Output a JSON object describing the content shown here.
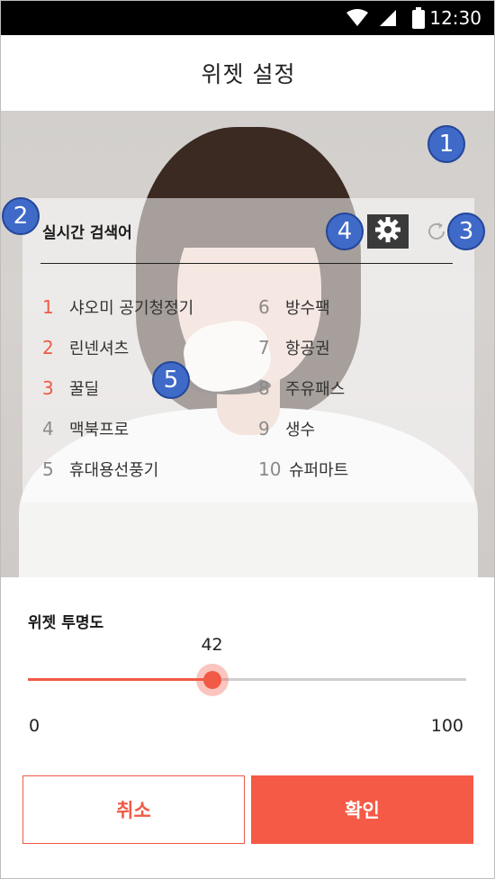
{
  "status_bar": {
    "time": "12:30",
    "icons": [
      "wifi-icon",
      "cell-signal-icon",
      "battery-icon"
    ]
  },
  "header": {
    "title": "위젯 설정"
  },
  "preview": {
    "widget": {
      "title": "실시간 검색어",
      "settings_icon": "gear-icon",
      "refresh_icon": "refresh-icon",
      "keywords_left": [
        {
          "rank": "1",
          "keyword": "샤오미 공기청정기",
          "hot": true
        },
        {
          "rank": "2",
          "keyword": "린넨셔츠",
          "hot": true
        },
        {
          "rank": "3",
          "keyword": "꿀딜",
          "hot": true
        },
        {
          "rank": "4",
          "keyword": "맥북프로",
          "hot": false
        },
        {
          "rank": "5",
          "keyword": "휴대용선풍기",
          "hot": false
        }
      ],
      "keywords_right": [
        {
          "rank": "6",
          "keyword": "방수팩"
        },
        {
          "rank": "7",
          "keyword": "항공권"
        },
        {
          "rank": "8",
          "keyword": "주유패스"
        },
        {
          "rank": "9",
          "keyword": "생수"
        },
        {
          "rank": "10",
          "keyword": "슈퍼마트"
        }
      ]
    },
    "markers": [
      "1",
      "2",
      "3",
      "4",
      "5"
    ]
  },
  "opacity": {
    "label": "위젯 투명도",
    "value": "42",
    "value_num": 42,
    "min": "0",
    "max": "100"
  },
  "buttons": {
    "cancel": "취소",
    "confirm": "확인"
  },
  "colors": {
    "accent": "#f05a46",
    "marker": "#3f6ac8",
    "status_bar": "#000000"
  }
}
